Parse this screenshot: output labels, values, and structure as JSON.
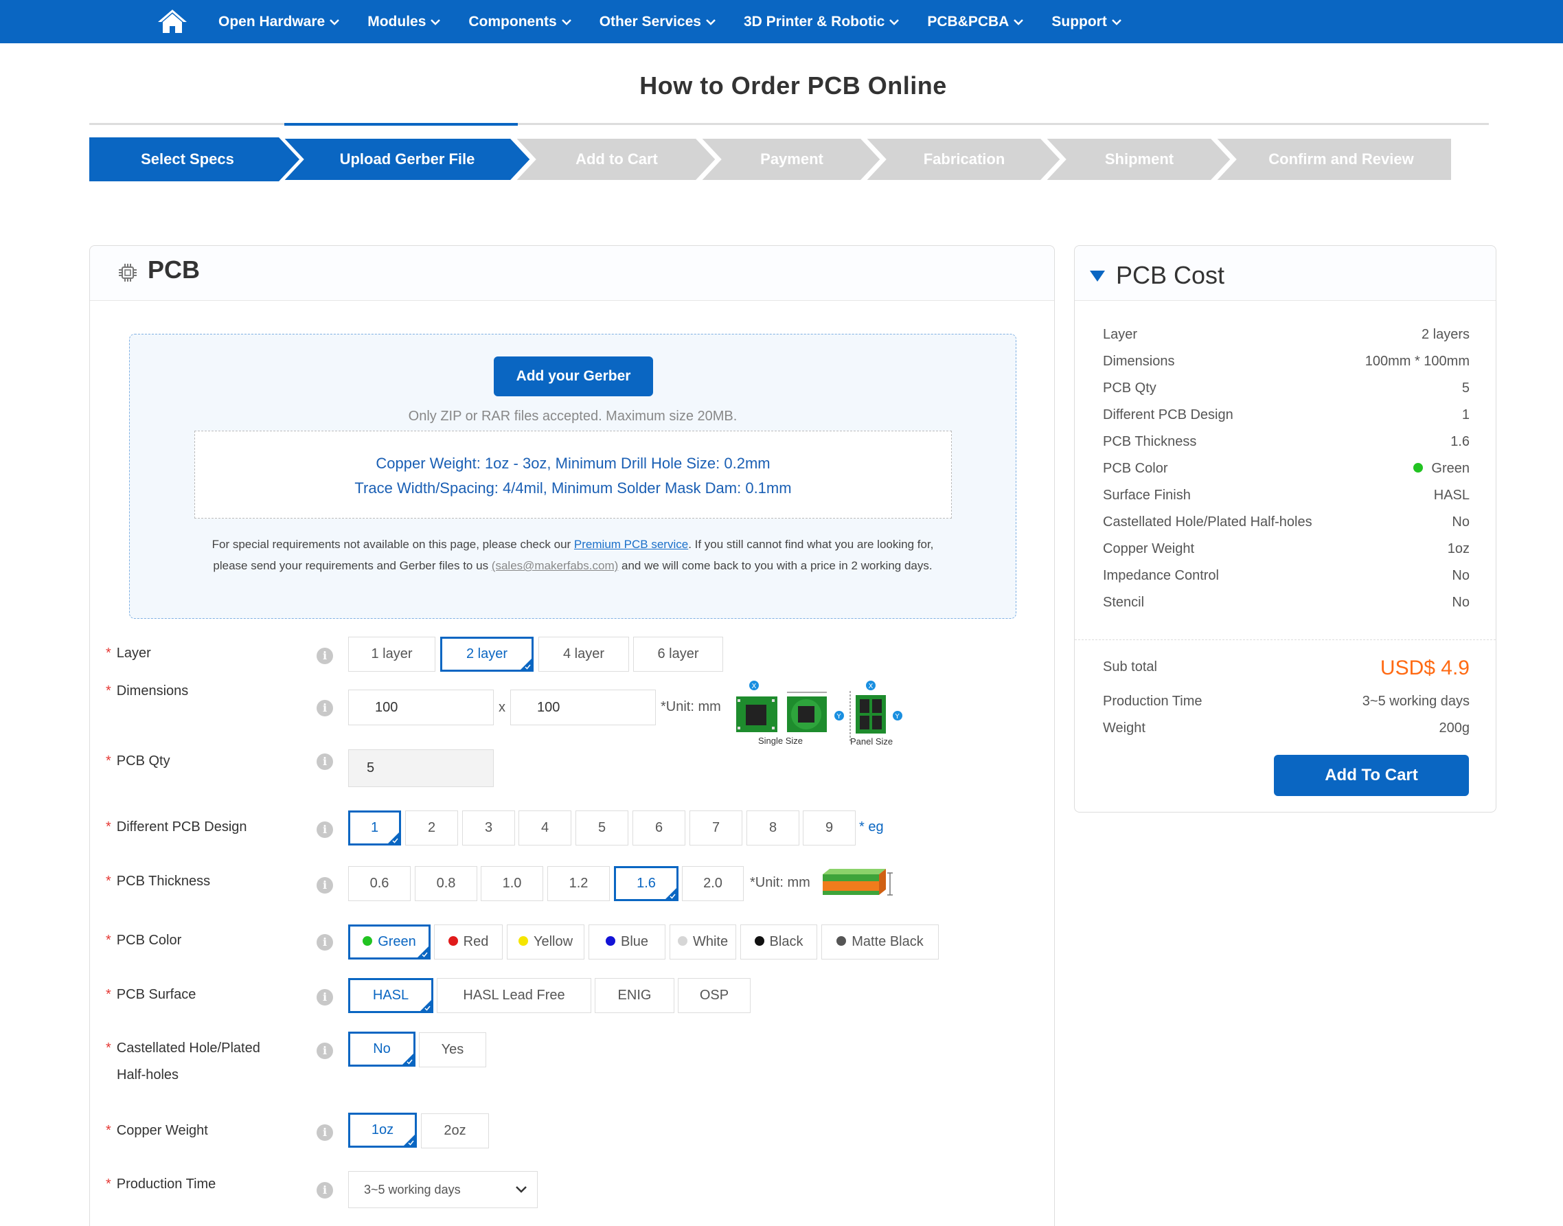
{
  "nav": {
    "home_icon": "home-icon",
    "items": [
      "Open Hardware",
      "Modules",
      "Components",
      "Other Services",
      "3D Printer & Robotic",
      "PCB&PCBA",
      "Support"
    ]
  },
  "page_title": "How to Order PCB Online",
  "steps": [
    "Select Specs",
    "Upload Gerber File",
    "Add to Cart",
    "Payment",
    "Fabrication",
    "Shipment",
    "Confirm and Review"
  ],
  "pcb_panel": {
    "title": "PCB",
    "icon": "chip-icon",
    "upload": {
      "button": "Add your Gerber",
      "note": "Only ZIP or RAR files accepted. Maximum size 20MB.",
      "spec_line1": "Copper Weight: 1oz - 3oz, Minimum Drill Hole Size: 0.2mm",
      "spec_line2": "Trace Width/Spacing: 4/4mil, Minimum Solder Mask Dam: 0.1mm",
      "special_pre": "For special requirements not available on this page, please check our ",
      "special_link": "Premium PCB service",
      "special_mid": ". If you still cannot find what you are looking for, please send your requirements and Gerber files to us ",
      "special_mail": "(sales@makerfabs.com)",
      "special_post": " and we will come back to you with a price in 2 working days."
    }
  },
  "form": {
    "layer": {
      "label": "Layer",
      "options": [
        "1 layer",
        "2 layer",
        "4 layer",
        "6 layer"
      ],
      "selected": "2 layer"
    },
    "dimensions": {
      "label": "Dimensions",
      "x": "100",
      "sep": "x",
      "y": "100",
      "unit": "*Unit: mm",
      "single_caption": "Single Size",
      "panel_caption": "Panel Size"
    },
    "qty": {
      "label": "PCB Qty",
      "value": "5"
    },
    "design": {
      "label": "Different PCB Design",
      "options": [
        "1",
        "2",
        "3",
        "4",
        "5",
        "6",
        "7",
        "8",
        "9"
      ],
      "selected": "1",
      "eg": "* eg"
    },
    "thickness": {
      "label": "PCB Thickness",
      "options": [
        "0.6",
        "0.8",
        "1.0",
        "1.2",
        "1.6",
        "2.0"
      ],
      "selected": "1.6",
      "unit": "*Unit: mm"
    },
    "color": {
      "label": "PCB Color",
      "options": [
        {
          "name": "Green",
          "color": "#22c322"
        },
        {
          "name": "Red",
          "color": "#e01b1b"
        },
        {
          "name": "Yellow",
          "color": "#f5e500"
        },
        {
          "name": "Blue",
          "color": "#1313d6"
        },
        {
          "name": "White",
          "color": "#d6d6d6"
        },
        {
          "name": "Black",
          "color": "#111111"
        },
        {
          "name": "Matte Black",
          "color": "#555555"
        }
      ],
      "selected": "Green"
    },
    "surface": {
      "label": "PCB Surface",
      "options": [
        "HASL",
        "HASL Lead Free",
        "ENIG",
        "OSP"
      ],
      "selected": "HASL"
    },
    "castellated": {
      "label_line1": "Castellated Hole/Plated",
      "label_line2": "Half-holes",
      "options": [
        "No",
        "Yes"
      ],
      "selected": "No"
    },
    "copper": {
      "label": "Copper Weight",
      "options": [
        "1oz",
        "2oz"
      ],
      "selected": "1oz"
    },
    "production": {
      "label": "Production Time",
      "value": "3~5 working days"
    }
  },
  "cost": {
    "title": "PCB Cost",
    "rows": [
      {
        "label": "Layer",
        "value": "2 layers"
      },
      {
        "label": "Dimensions",
        "value": "100mm * 100mm"
      },
      {
        "label": "PCB Qty",
        "value": "5"
      },
      {
        "label": "Different PCB Design",
        "value": "1"
      },
      {
        "label": "PCB Thickness",
        "value": "1.6"
      },
      {
        "label": "PCB Color",
        "value": "Green"
      },
      {
        "label": "Surface Finish",
        "value": "HASL"
      },
      {
        "label": "Castellated Hole/Plated Half-holes",
        "value": "No"
      },
      {
        "label": "Copper Weight",
        "value": "1oz"
      },
      {
        "label": "Impedance Control",
        "value": "No"
      },
      {
        "label": "Stencil",
        "value": "No"
      }
    ],
    "subtotal_label": "Sub total",
    "subtotal_value": "USD$ 4.9",
    "production_label": "Production Time",
    "production_value": "3~5 working days",
    "weight_label": "Weight",
    "weight_value": "200g",
    "cart_button": "Add To Cart",
    "color_dot": "#22c322"
  },
  "colors": {
    "primary": "#0a66c2",
    "accent": "#ff6a13",
    "required": "#e53935"
  }
}
